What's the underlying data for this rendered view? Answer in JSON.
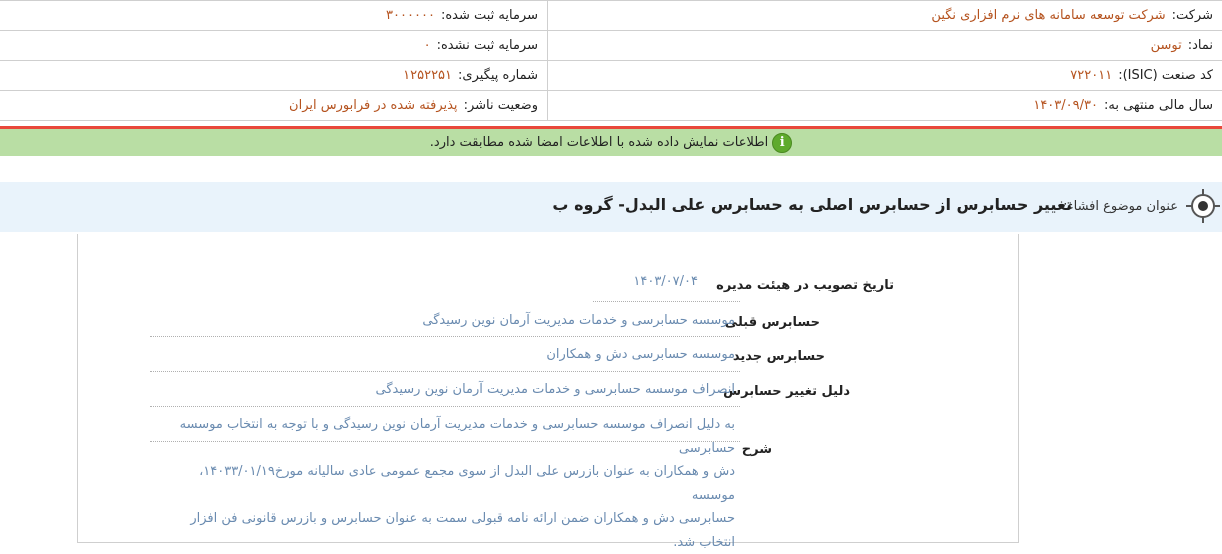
{
  "company_info": {
    "company_label": "شرکت:",
    "company_value": "شرکت توسعه سامانه های نرم افزاری نگین",
    "registered_capital_label": "سرمایه ثبت شده:",
    "registered_capital_value": "۳۰۰۰۰۰۰",
    "symbol_label": "نماد:",
    "symbol_value": "توسن",
    "unregistered_capital_label": "سرمایه ثبت نشده:",
    "unregistered_capital_value": "۰",
    "isic_label": "کد صنعت (ISIC):",
    "isic_value": "۷۲۲۰۱۱",
    "tracking_label": "شماره پیگیری:",
    "tracking_value": "۱۲۵۲۲۵۱",
    "fiscal_year_label": "سال مالی منتهی به:",
    "fiscal_year_value": "۱۴۰۳/۰۹/۳۰",
    "publisher_status_label": "وضعیت ناشر:",
    "publisher_status_value": "پذیرفته شده در فرابورس ایران"
  },
  "notice": {
    "icon": "info-icon",
    "text": "اطلاعات نمایش داده شده با اطلاعات امضا شده مطابقت دارد."
  },
  "subject": {
    "icon": "target-icon",
    "label": "عنوان موضوع افشاء:",
    "title": "تغییر حسابرس از حسابرس اصلی به حسابرس علی البدل- گروه ب"
  },
  "details": {
    "board_approval_date_label": "تاریخ تصویب در هیئت مدیره",
    "board_approval_date_value": "۱۴۰۳/۰۷/۰۴",
    "previous_auditor_label": "حسابرس قبلی",
    "previous_auditor_value": "موسسه حسابرسی و خدمات مدیریت آرمان نوین رسیدگی",
    "new_auditor_label": "حسابرس جدید",
    "new_auditor_value": "موسسه حسابرسی دش و همکاران",
    "change_reason_label": "دلیل تغییر حسابرس",
    "change_reason_value": "انصراف موسسه حسابرسی و خدمات مدیریت آرمان نوین رسیدگی",
    "description_label": "شرح",
    "description_lines": [
      "به دلیل انصراف موسسه حسابرسی و خدمات مدیریت آرمان نوین رسیدگی و با توجه به انتخاب موسسه حسابرسی",
      "دش و همکاران به عنوان بازرس علی البدل از سوی مجمع عمومی عادی سالیانه مورخ۱۴۰۳۳/۰۱/۱۹، موسسه",
      "حسابرسی دش و همکاران ضمن ارائه نامه قبولی سمت به عنوان حسابرس و بازرس قانونی فن افزار انتخاب شد."
    ]
  },
  "colors": {
    "value_orange": "#b5531f",
    "value_blue": "#6a8bb0",
    "notice_green": "#b9dea4",
    "alert_red": "#e8483b",
    "subject_bg": "#e9f3fb"
  }
}
